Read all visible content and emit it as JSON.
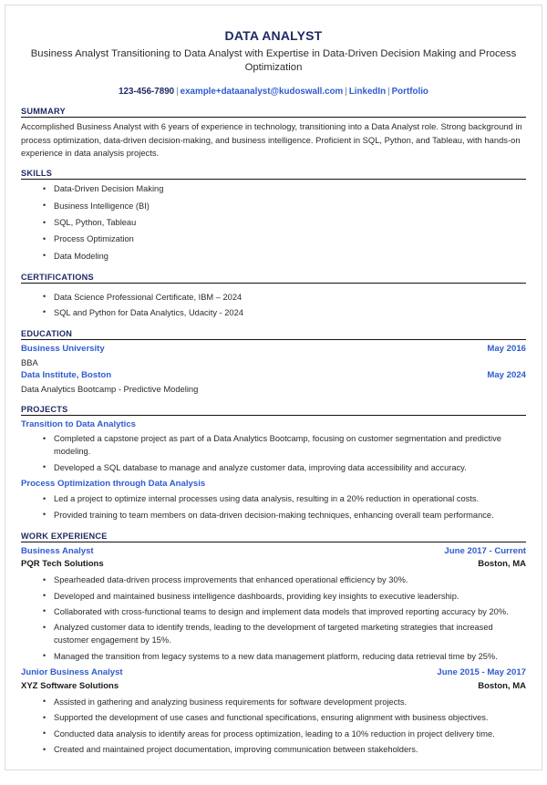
{
  "colors": {
    "navy": "#1f2a63",
    "link_blue": "#2f5bd0",
    "text": "#2b2b2b",
    "rule": "#111111"
  },
  "header": {
    "title": "DATA ANALYST",
    "subtitle": "Business Analyst Transitioning to Data Analyst with Expertise in Data-Driven Decision Making and Process Optimization",
    "phone": "123-456-7890",
    "email": "example+dataanalyst@kudoswall.com",
    "linkedin": "LinkedIn",
    "portfolio": "Portfolio",
    "separator": "|"
  },
  "summary": {
    "heading": "SUMMARY",
    "text": "Accomplished Business Analyst with 6 years of experience in technology, transitioning into a Data Analyst role. Strong background in process optimization, data-driven decision-making, and business intelligence. Proficient in SQL, Python, and Tableau, with hands-on experience in data analysis projects."
  },
  "skills": {
    "heading": "SKILLS",
    "items": [
      "Data-Driven Decision Making",
      "Business Intelligence (BI)",
      "SQL, Python, Tableau",
      "Process Optimization",
      "Data Modeling"
    ]
  },
  "certifications": {
    "heading": "CERTIFICATIONS",
    "items": [
      "Data Science Professional Certificate, IBM – 2024",
      "SQL and Python for Data Analytics, Udacity - 2024"
    ]
  },
  "education": {
    "heading": "EDUCATION",
    "entries": [
      {
        "school": "Business University",
        "date": "May 2016",
        "degree": "BBA"
      },
      {
        "school": "Data Institute, Boston",
        "date": "May 2024",
        "degree": "Data Analytics Bootcamp - Predictive Modeling"
      }
    ]
  },
  "projects": {
    "heading": "PROJECTS",
    "entries": [
      {
        "title": "Transition to Data Analytics",
        "bullets": [
          "Completed a capstone project as part of a Data Analytics Bootcamp, focusing on customer segmentation and predictive modeling.",
          "Developed a SQL database to manage and analyze customer data, improving data accessibility and accuracy."
        ]
      },
      {
        "title": "Process Optimization through Data Analysis",
        "bullets": [
          "Led a project to optimize internal processes using data analysis, resulting in a 20% reduction in operational costs.",
          "Provided training to team members on data-driven decision-making techniques, enhancing overall team performance."
        ]
      }
    ]
  },
  "work_experience": {
    "heading": "WORK EXPERIENCE",
    "entries": [
      {
        "job_title": "Business Analyst",
        "date": "June 2017 - Current",
        "company": "PQR Tech Solutions",
        "location": "Boston, MA",
        "bullets": [
          "Spearheaded data-driven process improvements that enhanced operational efficiency by 30%.",
          "Developed and maintained business intelligence dashboards, providing key insights to executive leadership.",
          "Collaborated with cross-functional teams to design and implement data models that improved reporting accuracy by 20%.",
          "Analyzed customer data to identify trends, leading to the development of targeted marketing strategies that increased customer engagement by 15%.",
          "Managed the transition from legacy systems to a new data management platform, reducing data retrieval time by 25%."
        ]
      },
      {
        "job_title": "Junior Business Analyst",
        "date": "June 2015 - May 2017",
        "company": "XYZ Software Solutions",
        "location": "Boston, MA",
        "bullets": [
          "Assisted in gathering and analyzing business requirements for software development projects.",
          "Supported the development of use cases and functional specifications, ensuring alignment with business objectives.",
          "Conducted data analysis to identify areas for process optimization, leading to a 10% reduction in project delivery time.",
          "Created and maintained project documentation, improving communication between stakeholders."
        ]
      }
    ]
  }
}
